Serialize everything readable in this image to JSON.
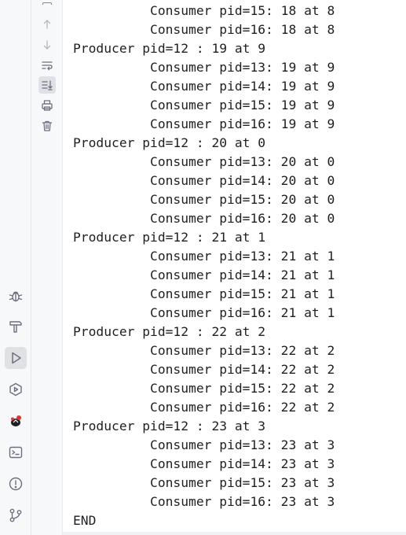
{
  "console": {
    "lines": [
      "          Consumer pid=15: 18 at 8",
      "          Consumer pid=16: 18 at 8",
      "Producer pid=12 : 19 at 9",
      "          Consumer pid=13: 19 at 9",
      "          Consumer pid=14: 19 at 9",
      "          Consumer pid=15: 19 at 9",
      "          Consumer pid=16: 19 at 9",
      "Producer pid=12 : 20 at 0",
      "          Consumer pid=13: 20 at 0",
      "          Consumer pid=14: 20 at 0",
      "          Consumer pid=15: 20 at 0",
      "          Consumer pid=16: 20 at 0",
      "Producer pid=12 : 21 at 1",
      "          Consumer pid=13: 21 at 1",
      "          Consumer pid=14: 21 at 1",
      "          Consumer pid=15: 21 at 1",
      "          Consumer pid=16: 21 at 1",
      "Producer pid=12 : 22 at 2",
      "          Consumer pid=13: 22 at 2",
      "          Consumer pid=14: 22 at 2",
      "          Consumer pid=15: 22 at 2",
      "          Consumer pid=16: 22 at 2",
      "Producer pid=12 : 23 at 3",
      "          Consumer pid=13: 23 at 3",
      "          Consumer pid=14: 23 at 3",
      "          Consumer pid=15: 23 at 3",
      "          Consumer pid=16: 23 at 3",
      "END"
    ]
  },
  "actions": [
    {
      "name": "scroll-up-icon",
      "active": false
    },
    {
      "name": "scroll-down-icon",
      "active": false
    },
    {
      "name": "soft-wrap-icon",
      "active": false
    },
    {
      "name": "scroll-to-end-icon",
      "active": true
    },
    {
      "name": "print-icon",
      "active": false
    },
    {
      "name": "clear-all-icon",
      "active": false
    }
  ],
  "tool_windows": [
    {
      "name": "debug-icon",
      "active": false
    },
    {
      "name": "build-hammer-icon",
      "active": false
    },
    {
      "name": "run-icon",
      "active": true
    },
    {
      "name": "services-icon",
      "active": false
    },
    {
      "name": "plugin-bug-icon",
      "active": false
    },
    {
      "name": "terminal-icon",
      "active": false
    },
    {
      "name": "problems-icon",
      "active": false
    },
    {
      "name": "git-icon",
      "active": false
    }
  ],
  "colors": {
    "text": "#1e1f22",
    "icon": "#6c707e",
    "active_bg": "#dfe1e5",
    "strip_bg": "#f7f8fa"
  }
}
